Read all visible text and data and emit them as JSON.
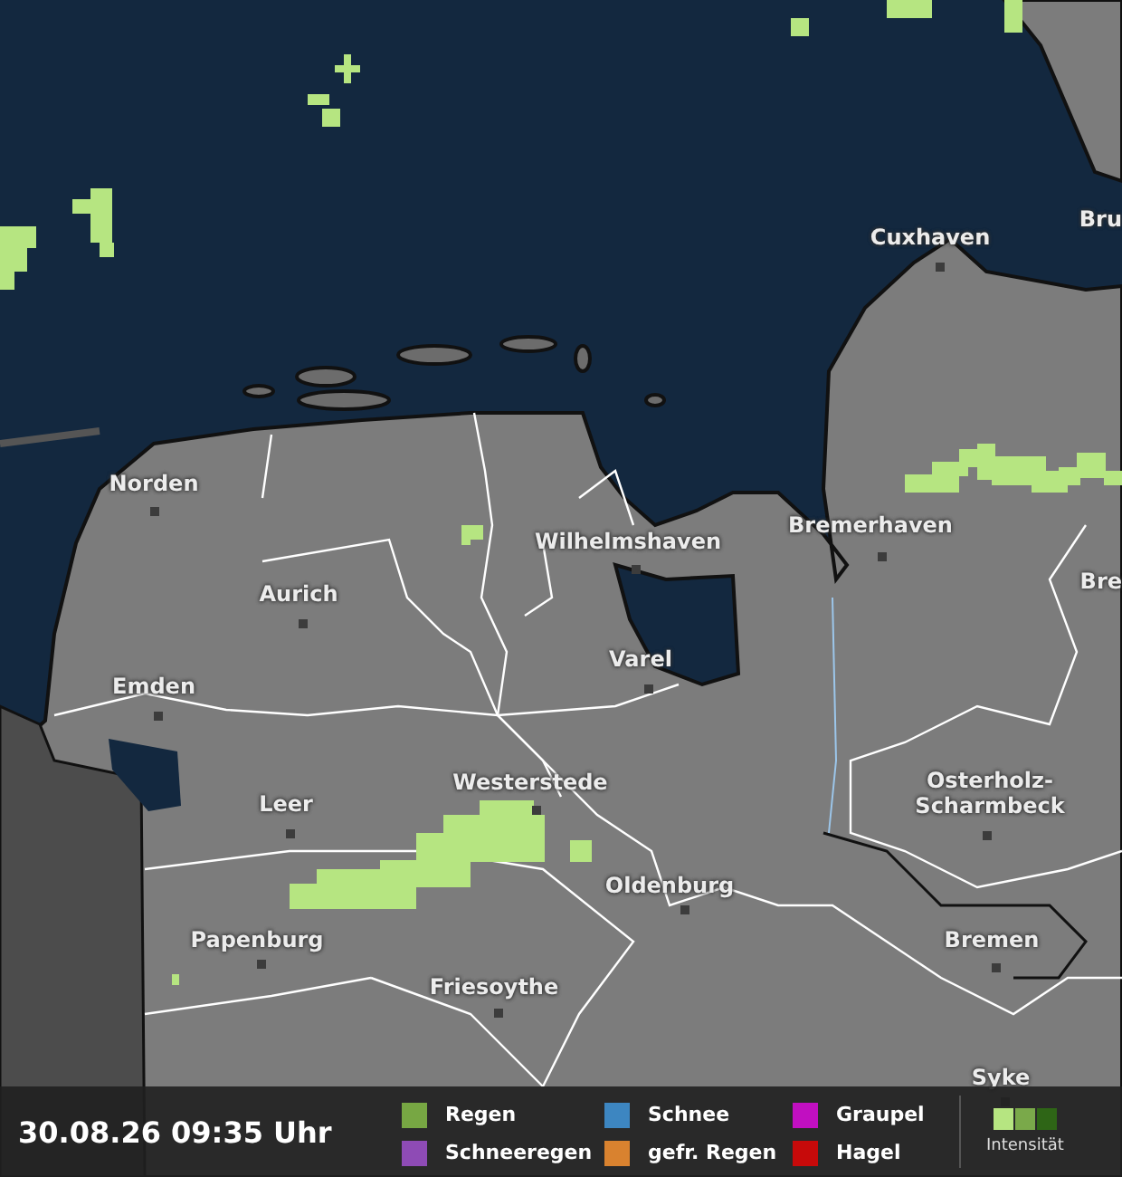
{
  "cities": [
    {
      "name": "Bru"
    },
    {
      "name": "Cuxhaven"
    },
    {
      "name": "Norden"
    },
    {
      "name": "Wilhelmshaven"
    },
    {
      "name": "Bremerhaven"
    },
    {
      "name": "Bre"
    },
    {
      "name": "Aurich"
    },
    {
      "name": "Varel"
    },
    {
      "name": "Emden"
    },
    {
      "name": "Leer"
    },
    {
      "name": "Westerstede"
    },
    {
      "name": "Osterholz-Scharmbeck"
    },
    {
      "name": "Oldenburg"
    },
    {
      "name": "Papenburg"
    },
    {
      "name": "Bremen"
    },
    {
      "name": "Friesoythe"
    },
    {
      "name": "Syke"
    }
  ],
  "status_bar": {
    "timestamp": "30.08.26 09:35 Uhr",
    "legend": [
      {
        "label": "Regen",
        "color": "#77a743"
      },
      {
        "label": "Schneeregen",
        "color": "#8e4bb5"
      },
      {
        "label": "Schnee",
        "color": "#3d86c1"
      },
      {
        "label": "gefr. Regen",
        "color": "#d9822f"
      },
      {
        "label": "Graupel",
        "color": "#c10fc1"
      },
      {
        "label": "Hagel",
        "color": "#c70a0a"
      }
    ],
    "intensity": {
      "label": "Intensität",
      "levels": [
        {
          "color": "#b6e581"
        },
        {
          "color": "#7aa94a"
        },
        {
          "color": "#2e6516"
        }
      ]
    }
  }
}
